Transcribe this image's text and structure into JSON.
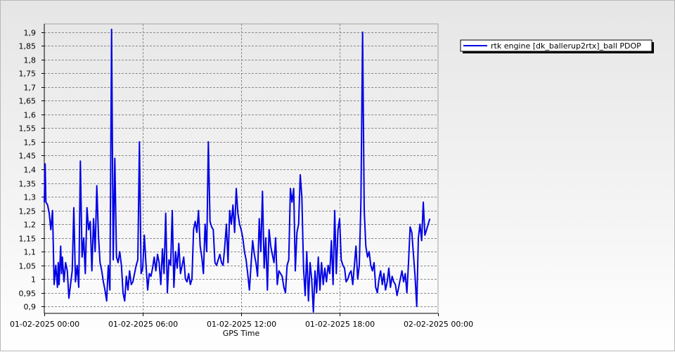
{
  "chart_data": {
    "type": "line",
    "xlabel": "GPS Time",
    "ylabel": "",
    "x_tick_labels": [
      "01-02-2025 00:00",
      "01-02-2025 06:00",
      "01-02-2025 12:00",
      "01-02-2025 18:00",
      "02-02-2025 00:00"
    ],
    "y_tick_labels": [
      "0,9",
      "0,95",
      "1",
      "1,05",
      "1,1",
      "1,15",
      "1,2",
      "1,25",
      "1,3",
      "1,35",
      "1,4",
      "1,45",
      "1,5",
      "1,55",
      "1,6",
      "1,65",
      "1,7",
      "1,75",
      "1,8",
      "1,85",
      "1,9"
    ],
    "x_range_hours": [
      0,
      24
    ],
    "ylim": [
      0.875,
      1.93
    ],
    "grid": true,
    "legend_position": "top-right",
    "series": [
      {
        "name": "rtk engine [dk_ballerup2rtx]_ball PDOP",
        "color": "#0000e6",
        "x_hours": [
          0.0,
          0.05,
          0.1,
          0.2,
          0.3,
          0.4,
          0.5,
          0.6,
          0.7,
          0.8,
          0.85,
          0.9,
          1.0,
          1.05,
          1.1,
          1.2,
          1.3,
          1.4,
          1.5,
          1.6,
          1.7,
          1.8,
          1.9,
          2.0,
          2.1,
          2.2,
          2.3,
          2.4,
          2.5,
          2.6,
          2.7,
          2.8,
          2.9,
          3.0,
          3.1,
          3.2,
          3.3,
          3.4,
          3.5,
          3.6,
          3.7,
          3.8,
          3.9,
          4.0,
          4.1,
          4.2,
          4.3,
          4.4,
          4.5,
          4.6,
          4.7,
          4.8,
          4.9,
          5.0,
          5.1,
          5.2,
          5.3,
          5.4,
          5.5,
          5.6,
          5.7,
          5.8,
          5.9,
          6.0,
          6.1,
          6.2,
          6.3,
          6.4,
          6.5,
          6.6,
          6.7,
          6.8,
          6.9,
          7.0,
          7.1,
          7.2,
          7.3,
          7.4,
          7.5,
          7.6,
          7.7,
          7.8,
          7.9,
          8.0,
          8.1,
          8.2,
          8.3,
          8.4,
          8.5,
          8.6,
          8.7,
          8.8,
          8.9,
          9.0,
          9.1,
          9.2,
          9.3,
          9.4,
          9.5,
          9.6,
          9.7,
          9.8,
          9.9,
          10.0,
          10.1,
          10.2,
          10.3,
          10.4,
          10.5,
          10.6,
          10.7,
          10.8,
          10.9,
          11.0,
          11.1,
          11.2,
          11.3,
          11.4,
          11.5,
          11.6,
          11.7,
          11.8,
          11.9,
          12.0,
          12.1,
          12.2,
          12.3,
          12.4,
          12.5,
          12.6,
          12.7,
          12.8,
          12.9,
          13.0,
          13.1,
          13.2,
          13.3,
          13.4,
          13.5,
          13.6,
          13.7,
          13.8,
          13.9,
          14.0,
          14.1,
          14.2,
          14.3,
          14.4,
          14.5,
          14.6,
          14.7,
          14.8,
          14.9,
          15.0,
          15.1,
          15.2,
          15.3,
          15.4,
          15.5,
          15.6,
          15.7,
          15.8,
          15.9,
          16.0,
          16.1,
          16.2,
          16.3,
          16.4,
          16.5,
          16.6,
          16.7,
          16.8,
          16.9,
          17.0,
          17.1,
          17.2,
          17.3,
          17.4,
          17.5,
          17.6,
          17.7,
          17.8,
          17.9,
          18.0,
          18.1,
          18.2,
          18.3,
          18.4,
          18.5,
          18.6,
          18.7,
          18.8,
          18.9,
          19.0,
          19.1,
          19.2,
          19.3,
          19.4,
          19.5,
          19.6,
          19.7,
          19.8,
          19.9,
          20.0,
          20.1,
          20.2,
          20.3,
          20.4,
          20.5,
          20.6,
          20.7,
          20.8,
          20.9,
          21.0,
          21.1,
          21.2,
          21.3,
          21.4,
          21.5,
          21.6,
          21.7,
          21.8,
          21.9,
          22.0,
          22.1,
          22.2,
          22.3,
          22.4,
          22.5,
          22.6,
          22.7,
          22.8,
          22.9,
          23.0,
          23.1,
          23.2,
          23.3,
          23.4,
          23.5,
          23.6,
          23.7,
          23.8,
          23.9,
          24.0
        ],
        "y": [
          1.28,
          1.42,
          1.28,
          1.27,
          1.24,
          1.18,
          1.25,
          0.98,
          1.05,
          0.97,
          1.06,
          0.98,
          1.12,
          1.02,
          1.08,
          0.99,
          1.06,
          1.03,
          0.93,
          0.98,
          1.03,
          1.26,
          0.99,
          1.05,
          0.97,
          1.43,
          1.08,
          1.15,
          1.02,
          1.26,
          1.18,
          1.21,
          1.03,
          1.22,
          1.1,
          1.34,
          1.16,
          1.06,
          1.03,
          0.99,
          0.96,
          0.92,
          1.05,
          0.96,
          1.91,
          1.07,
          1.44,
          1.08,
          1.06,
          1.1,
          1.05,
          0.95,
          0.92,
          1.01,
          0.96,
          1.03,
          0.98,
          0.99,
          1.02,
          1.05,
          1.07,
          1.5,
          1.02,
          1.04,
          1.16,
          1.05,
          0.96,
          1.02,
          1.01,
          1.04,
          1.08,
          1.03,
          1.09,
          1.06,
          0.98,
          1.11,
          1.02,
          1.24,
          0.95,
          1.07,
          1.05,
          1.25,
          0.97,
          1.1,
          1.04,
          1.13,
          1.02,
          1.05,
          1.08,
          1.0,
          0.99,
          1.02,
          0.98,
          1.0,
          1.18,
          1.21,
          1.17,
          1.25,
          1.12,
          1.08,
          1.02,
          1.2,
          1.1,
          1.5,
          1.21,
          1.19,
          1.18,
          1.06,
          1.05,
          1.07,
          1.09,
          1.06,
          1.05,
          1.12,
          1.2,
          1.06,
          1.25,
          1.2,
          1.27,
          1.17,
          1.33,
          1.24,
          1.2,
          1.18,
          1.15,
          1.1,
          1.07,
          1.02,
          0.96,
          1.05,
          1.14,
          1.09,
          1.06,
          1.01,
          1.22,
          1.1,
          1.32,
          1.04,
          1.15,
          0.96,
          1.18,
          1.12,
          1.09,
          1.06,
          1.15,
          0.98,
          1.03,
          1.02,
          1.01,
          0.97,
          0.95,
          1.05,
          1.07,
          1.33,
          1.28,
          1.33,
          1.03,
          1.17,
          1.2,
          1.38,
          1.3,
          1.04,
          0.94,
          1.1,
          0.92,
          1.06,
          1.0,
          0.88,
          1.03,
          0.95,
          1.08,
          0.96,
          1.06,
          0.98,
          1.04,
          0.99,
          1.05,
          1.02,
          1.14,
          0.98,
          1.25,
          1.02,
          1.18,
          1.22,
          1.07,
          1.05,
          1.04,
          0.99,
          1.0,
          1.02,
          1.03,
          0.98,
          1.05,
          1.12,
          1.0,
          1.05,
          1.28,
          1.9,
          1.25,
          1.12,
          1.08,
          1.1,
          1.05,
          1.03,
          1.06,
          0.97,
          0.95,
          1.0,
          1.03,
          0.98,
          1.02,
          0.96,
          0.99,
          1.04,
          0.97,
          1.01,
          0.99,
          0.98,
          0.94,
          0.97,
          1.0,
          1.03,
          0.99,
          1.02,
          0.95,
          1.06,
          1.19,
          1.17,
          1.09,
          1.01,
          0.9,
          1.15,
          1.2,
          1.14,
          1.28,
          1.16,
          1.18,
          1.2,
          1.22
        ]
      }
    ]
  }
}
